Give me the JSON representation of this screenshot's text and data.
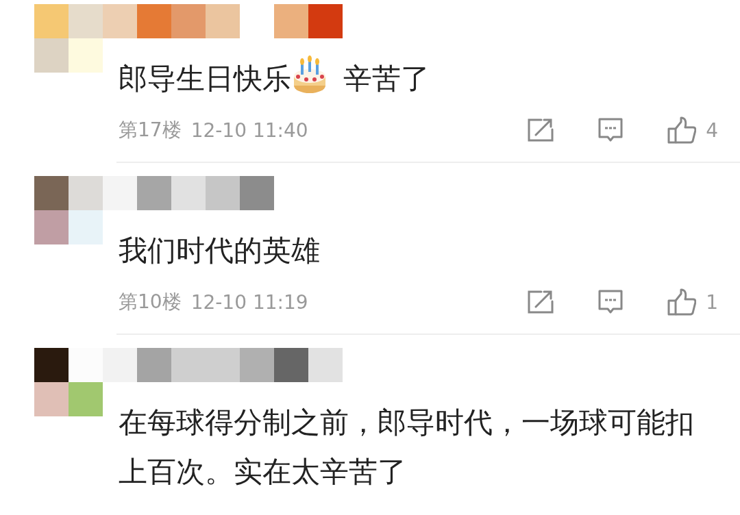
{
  "comments": [
    {
      "segments": [
        {
          "kind": "text",
          "text": "郎导生日快乐"
        },
        {
          "kind": "cake"
        },
        {
          "kind": "text",
          "text": "辛苦了"
        }
      ],
      "floor": "第17楼",
      "time": "12-10 11:40",
      "likes": "4"
    },
    {
      "segments": [
        {
          "kind": "text",
          "text": "我们时代的英雄"
        }
      ],
      "floor": "第10楼",
      "time": "12-10 11:19",
      "likes": "1"
    },
    {
      "segments": [
        {
          "kind": "text",
          "text": "在每球得分制之前，郎导时代，一场球可能扣上百次。实在太辛苦了"
        }
      ]
    }
  ]
}
